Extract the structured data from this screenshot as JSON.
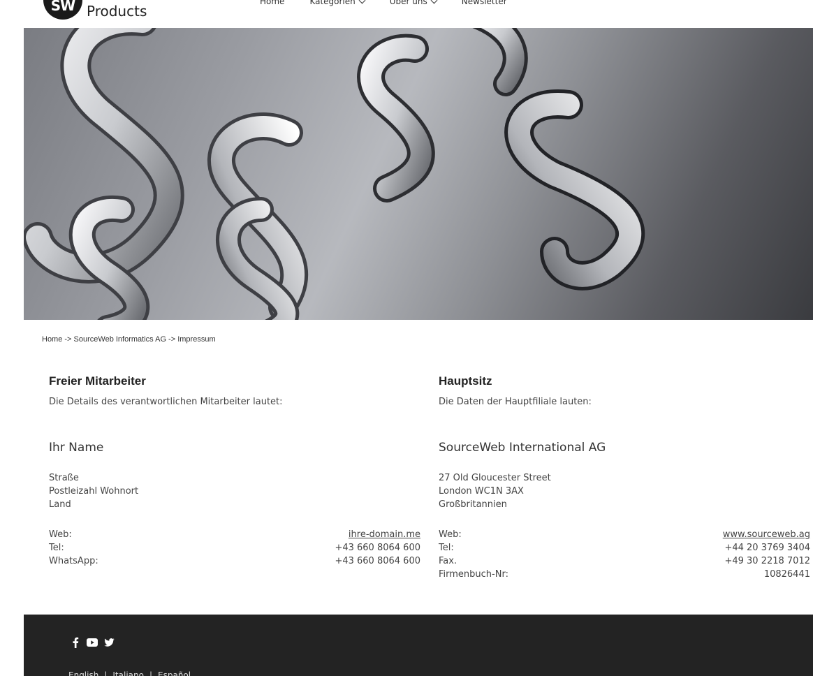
{
  "header": {
    "logo_initials": "SW",
    "logo_text": "Products",
    "nav": [
      {
        "label": "Home"
      },
      {
        "label": "Kategorien"
      },
      {
        "label": "Über uns"
      },
      {
        "label": "Newsletter"
      }
    ]
  },
  "breadcrumb": "Home -> SourceWeb Informatics AG -> Impressum",
  "left": {
    "title": "Freier Mitarbeiter",
    "subtitle": "Die Details des verantwortlichen Mitarbeiter lautet:",
    "name": "Ihr Name",
    "address": [
      "Straße",
      "Postleizahl Wohnort",
      "Land"
    ],
    "rows": [
      {
        "label": "Web:",
        "value": "ihre-domain.me"
      },
      {
        "label": "Tel:",
        "value": "+43 660 8064 600"
      },
      {
        "label": "WhatsApp:",
        "value": "+43 660 8064 600"
      }
    ]
  },
  "right": {
    "title": "Hauptsitz",
    "subtitle": "Die Daten der Hauptfiliale lauten:",
    "name": "SourceWeb International AG",
    "address": [
      "27 Old Gloucester Street",
      "London WC1N 3AX",
      "Großbritannien"
    ],
    "rows": [
      {
        "label": "Web:",
        "value": "www.sourceweb.ag"
      },
      {
        "label": "Tel:",
        "value": "+44 20 3769 3404"
      },
      {
        "label": "Fax.",
        "value": "+49 30 2218 7012"
      },
      {
        "label": "Firmenbuch-Nr:",
        "value": "10826441"
      }
    ]
  },
  "footer": {
    "social": [
      "facebook-icon",
      "youtube-icon",
      "twitter-icon"
    ],
    "languages": {
      "english": "English",
      "sep1": "|",
      "italiano": "Italiano",
      "sep2": "|",
      "espanol": "Español"
    }
  },
  "colors": {
    "footer_bg": "#232323",
    "text": "#333333"
  }
}
